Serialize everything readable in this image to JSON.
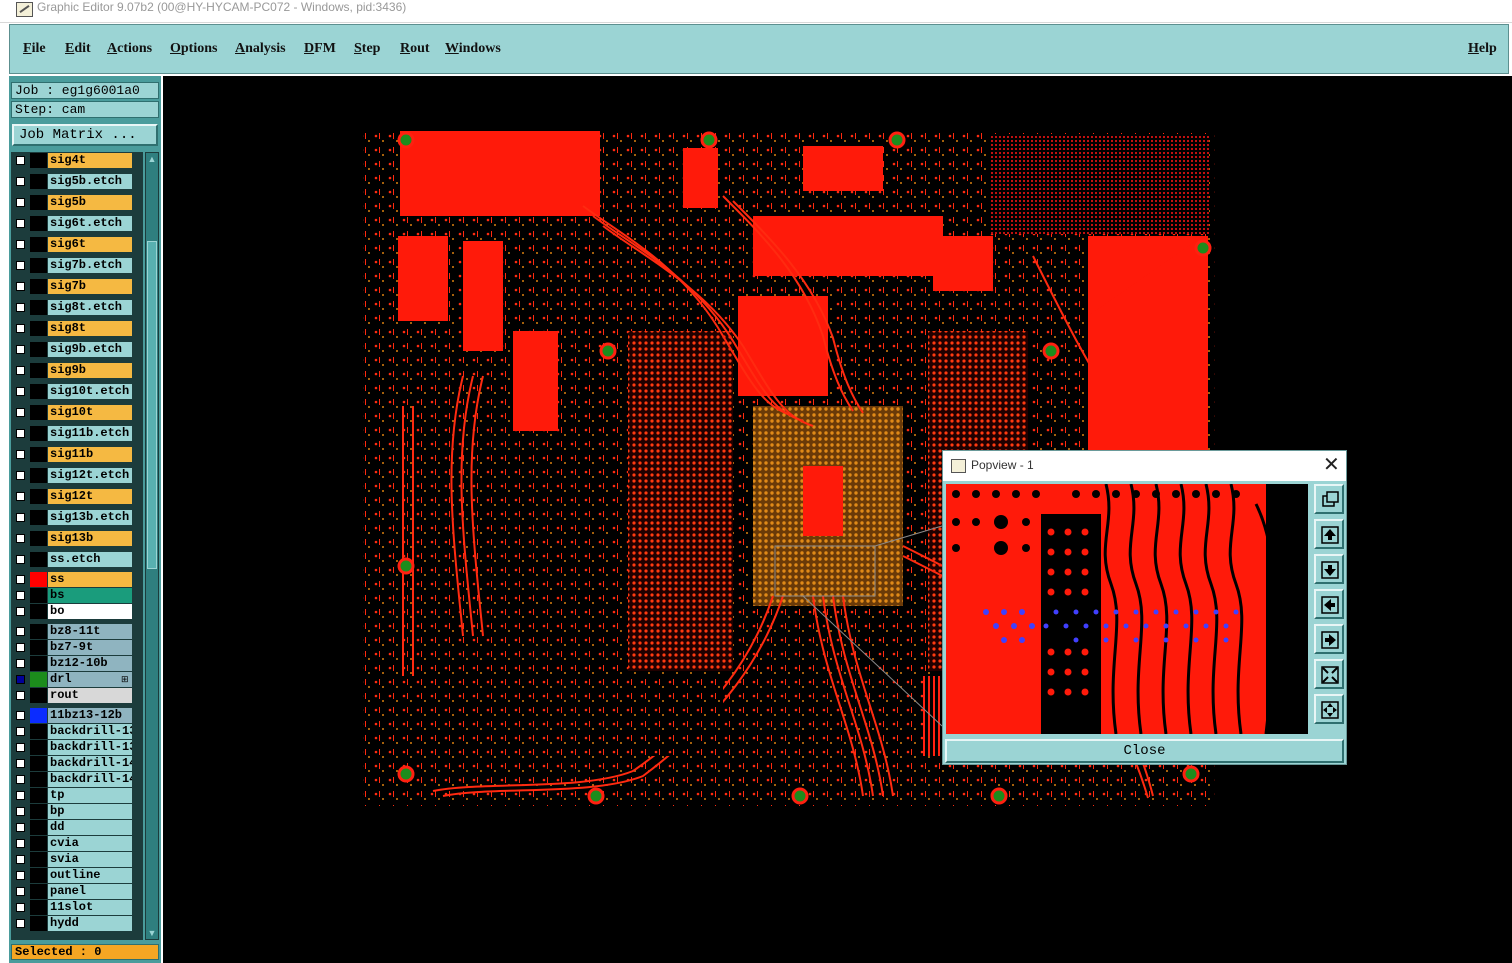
{
  "window": {
    "title": "Graphic Editor 9.07b2 (00@HY-HYCAM-PC072 - Windows, pid:3436)"
  },
  "menu": {
    "items": [
      "File",
      "Edit",
      "Actions",
      "Options",
      "Analysis",
      "DFM",
      "Step",
      "Rout",
      "Windows"
    ],
    "help": "Help"
  },
  "job": {
    "label": "Job : eg1g6001a0",
    "step": "Step: cam",
    "matrix_button": "Job Matrix ..."
  },
  "layers": [
    {
      "name": "sig4t",
      "color": "#f5b942",
      "selected": false,
      "swatch": "#000"
    },
    {
      "name": "sig5b.etch",
      "color": "#9bd4d4",
      "selected": false,
      "swatch": "#000"
    },
    {
      "name": "sig5b",
      "color": "#f5b942",
      "selected": false,
      "swatch": "#000"
    },
    {
      "name": "sig6t.etch",
      "color": "#9bd4d4",
      "selected": false,
      "swatch": "#000"
    },
    {
      "name": "sig6t",
      "color": "#f5b942",
      "selected": false,
      "swatch": "#000"
    },
    {
      "name": "sig7b.etch",
      "color": "#9bd4d4",
      "selected": false,
      "swatch": "#000"
    },
    {
      "name": "sig7b",
      "color": "#f5b942",
      "selected": false,
      "swatch": "#000"
    },
    {
      "name": "sig8t.etch",
      "color": "#9bd4d4",
      "selected": false,
      "swatch": "#000"
    },
    {
      "name": "sig8t",
      "color": "#f5b942",
      "selected": false,
      "swatch": "#000"
    },
    {
      "name": "sig9b.etch",
      "color": "#9bd4d4",
      "selected": false,
      "swatch": "#000"
    },
    {
      "name": "sig9b",
      "color": "#f5b942",
      "selected": false,
      "swatch": "#000"
    },
    {
      "name": "sig10t.etch",
      "color": "#9bd4d4",
      "selected": false,
      "swatch": "#000"
    },
    {
      "name": "sig10t",
      "color": "#f5b942",
      "selected": false,
      "swatch": "#000"
    },
    {
      "name": "sig11b.etch",
      "color": "#9bd4d4",
      "selected": false,
      "swatch": "#000"
    },
    {
      "name": "sig11b",
      "color": "#f5b942",
      "selected": false,
      "swatch": "#000"
    },
    {
      "name": "sig12t.etch",
      "color": "#9bd4d4",
      "selected": false,
      "swatch": "#000"
    },
    {
      "name": "sig12t",
      "color": "#f5b942",
      "selected": false,
      "swatch": "#000"
    },
    {
      "name": "sig13b.etch",
      "color": "#9bd4d4",
      "selected": false,
      "swatch": "#000"
    },
    {
      "name": "sig13b",
      "color": "#f5b942",
      "selected": false,
      "swatch": "#000"
    },
    {
      "name": "ss.etch",
      "color": "#9bd4d4",
      "selected": false,
      "swatch": "#000"
    },
    {
      "name": "ss",
      "color": "#f5b942",
      "selected": false,
      "swatch": "#ff0000"
    },
    {
      "name": "bs",
      "color": "#1a9c7c",
      "selected": false,
      "swatch": "#000"
    },
    {
      "name": "bo",
      "color": "#ffffff",
      "selected": false,
      "swatch": "#000"
    },
    {
      "name": "bz8-11t",
      "color": "#8fb4c0",
      "selected": false,
      "swatch": "#000"
    },
    {
      "name": "bz7-9t",
      "color": "#8fb4c0",
      "selected": false,
      "swatch": "#000"
    },
    {
      "name": "bz12-10b",
      "color": "#8fb4c0",
      "selected": false,
      "swatch": "#000"
    },
    {
      "name": "drl",
      "color": "#8fb4c0",
      "selected": true,
      "swatch": "#1c8c1c",
      "marker": "⊞"
    },
    {
      "name": "rout",
      "color": "#d8d8d8",
      "selected": false,
      "swatch": "#000"
    },
    {
      "name": "11bz13-12b",
      "color": "#8fb4c0",
      "selected": false,
      "swatch": "#0b2cff"
    },
    {
      "name": "backdrill-13",
      "color": "#9bd4d4",
      "selected": false,
      "swatch": "#000"
    },
    {
      "name": "backdrill-13",
      "color": "#9bd4d4",
      "selected": false,
      "swatch": "#000"
    },
    {
      "name": "backdrill-14",
      "color": "#9bd4d4",
      "selected": false,
      "swatch": "#000"
    },
    {
      "name": "backdrill-14",
      "color": "#9bd4d4",
      "selected": false,
      "swatch": "#000"
    },
    {
      "name": "tp",
      "color": "#9bd4d4",
      "selected": false,
      "swatch": "#000"
    },
    {
      "name": "bp",
      "color": "#9bd4d4",
      "selected": false,
      "swatch": "#000"
    },
    {
      "name": "dd",
      "color": "#9bd4d4",
      "selected": false,
      "swatch": "#000"
    },
    {
      "name": "cvia",
      "color": "#9bd4d4",
      "selected": false,
      "swatch": "#000"
    },
    {
      "name": "svia",
      "color": "#9bd4d4",
      "selected": false,
      "swatch": "#000"
    },
    {
      "name": "outline",
      "color": "#9bd4d4",
      "selected": false,
      "swatch": "#000"
    },
    {
      "name": "panel",
      "color": "#9bd4d4",
      "selected": false,
      "swatch": "#000"
    },
    {
      "name": "11slot",
      "color": "#9bd4d4",
      "selected": false,
      "swatch": "#000"
    },
    {
      "name": "hydd",
      "color": "#9bd4d4",
      "selected": false,
      "swatch": "#000"
    }
  ],
  "status": {
    "selected": "Selected : 0"
  },
  "popview": {
    "title": "Popview - 1",
    "close_label": "Close",
    "tools": [
      "window-restore-icon",
      "up-arrow-icon",
      "down-arrow-icon",
      "left-arrow-icon",
      "right-arrow-icon",
      "zoom-fit-icon",
      "pan-icon"
    ]
  },
  "colors": {
    "copper": "#ff1a0a",
    "pad": "#d88010",
    "menu_bg": "#9bd4d4",
    "panel_bg": "#4a9c9c",
    "drill": "#1c8c1c",
    "via_marker": "#4040ff"
  }
}
